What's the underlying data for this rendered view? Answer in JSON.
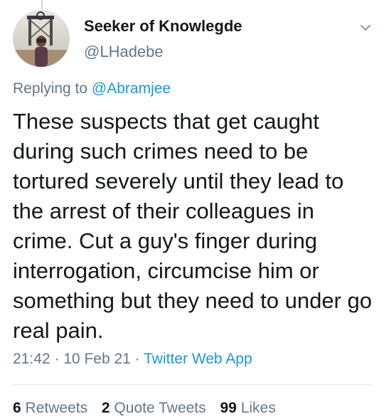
{
  "tweet": {
    "author_name": "Seeker of Knowlegde",
    "author_handle": "@LHadebe",
    "replying_prefix": "Replying to",
    "replying_to": "@Abramjee",
    "text": "These suspects that get caught during such crimes need to be tortured severely until they lead to the arrest of their colleagues in crime. Cut a guy's finger during interrogation, circumcise him or something but they need to under go real pain.",
    "time": "21:42",
    "date": "10 Feb 21",
    "source": "Twitter Web App",
    "separator": "·"
  },
  "stats": {
    "retweets_count": "6",
    "retweets_label": "Retweets",
    "quotes_count": "2",
    "quotes_label": "Quote Tweets",
    "likes_count": "99",
    "likes_label": "Likes"
  },
  "icons": {
    "menu": "chevron-down-icon",
    "avatar": "profile-photo"
  },
  "colors": {
    "link": "#1b95e0",
    "secondary_text": "#657786",
    "primary_text": "#14171a",
    "divider": "#e1e8ed"
  }
}
